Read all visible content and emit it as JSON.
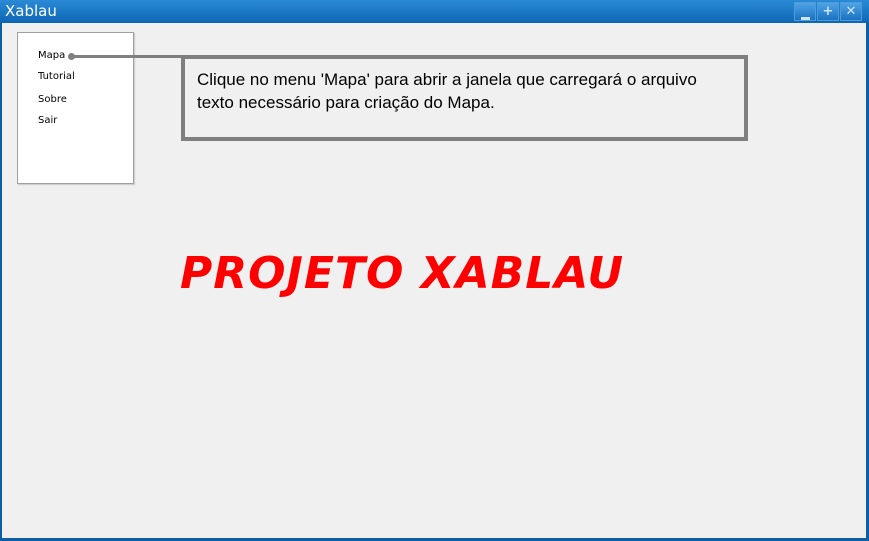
{
  "window": {
    "title": "Xablau",
    "buttons": {
      "minimize_icon": "minimize-icon",
      "maximize_glyph": "+",
      "close_glyph": "✕"
    }
  },
  "menu": {
    "items": [
      {
        "label": "Mapa"
      },
      {
        "label": "Tutorial"
      },
      {
        "label": "Sobre"
      },
      {
        "label": "Sair"
      }
    ]
  },
  "callout": {
    "text": "Clique no menu 'Mapa' para abrir a janela que carregará o arquivo texto necessário para criação do Mapa."
  },
  "main": {
    "title": "PROJETO XABLAU"
  },
  "colors": {
    "titlebar": "#1b78c6",
    "background": "#f0f0f0",
    "accent_title": "#ff0000",
    "callout_border": "#7f7f7f"
  }
}
